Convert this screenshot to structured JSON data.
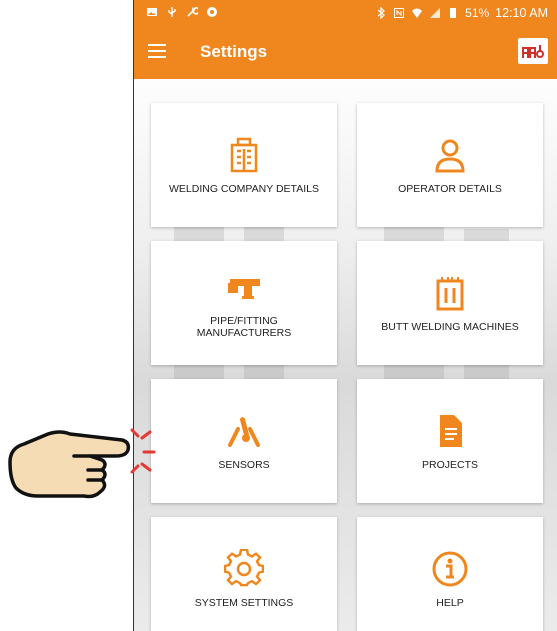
{
  "status_bar": {
    "battery": "51%",
    "time": "12:10 AM"
  },
  "app_bar": {
    "title": "Settings"
  },
  "tiles": [
    {
      "label": "WELDING COMPANY DETAILS",
      "icon": "building-icon"
    },
    {
      "label": "OPERATOR DETAILS",
      "icon": "user-icon"
    },
    {
      "label": "PIPE/FITTING MANUFACTURERS",
      "icon": "pipe-fitting-icon"
    },
    {
      "label": "BUTT WELDING MACHINES",
      "icon": "welding-machine-icon"
    },
    {
      "label": "SENSORS",
      "icon": "thermometer-sensor-icon"
    },
    {
      "label": "PROJECTS",
      "icon": "document-icon"
    },
    {
      "label": "SYSTEM SETTINGS",
      "icon": "gear-icon"
    },
    {
      "label": "HELP",
      "icon": "info-icon"
    }
  ],
  "colors": {
    "accent": "#f0871e",
    "icon": "#f0871e",
    "hand_fill": "#f5dcb5",
    "hand_rays": "#e53935"
  }
}
